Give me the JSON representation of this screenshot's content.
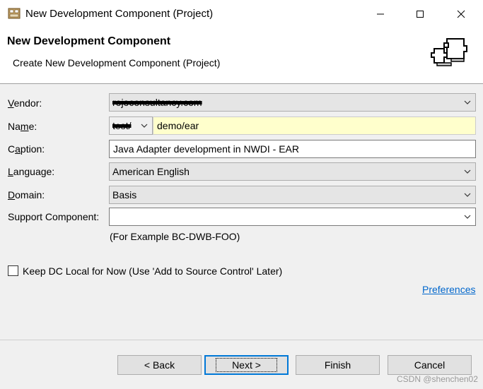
{
  "window": {
    "title": "New Development Component (Project)",
    "app_icon": "wizard-app-icon",
    "controls": [
      "minimize-icon",
      "maximize-icon",
      "close-icon"
    ]
  },
  "banner": {
    "title": "New Development Component",
    "description": "Create New Development Component (Project)",
    "icon": "puzzle-pieces-icon"
  },
  "form": {
    "vendor": {
      "label": "Vendor:",
      "value": "rojoconsultancy.com"
    },
    "name": {
      "label": "Name:",
      "prefix": "test/",
      "value": "demo/ear"
    },
    "caption": {
      "label": "Caption:",
      "value": "Java Adapter development in NWDI - EAR"
    },
    "language": {
      "label": "Language:",
      "value": "American English"
    },
    "domain": {
      "label": "Domain:",
      "value": "Basis"
    },
    "support_component": {
      "label": "Support Component:",
      "value": "",
      "example": "(For Example BC-DWB-FOO)"
    },
    "keep_local": {
      "label": "Keep DC Local for Now (Use 'Add to Source Control' Later)",
      "checked": false
    },
    "preferences_link": "Preferences"
  },
  "buttons": {
    "back": "< Back",
    "next": "Next >",
    "finish": "Finish",
    "cancel": "Cancel"
  },
  "watermark": "CSDN @shenchen02",
  "colors": {
    "link": "#0066cc",
    "name_field_bg": "#ffffcc",
    "default_button_border": "#0078d7"
  }
}
